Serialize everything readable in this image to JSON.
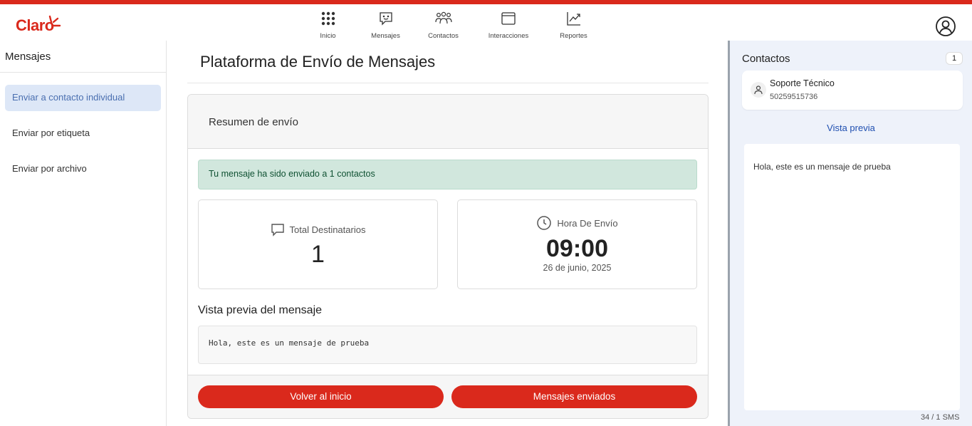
{
  "brand": {
    "logo_text": "Claro",
    "accent_color": "#da291c"
  },
  "nav": {
    "items": [
      {
        "label": "Inicio",
        "icon": "grid-icon"
      },
      {
        "label": "Mensajes",
        "icon": "message-icon"
      },
      {
        "label": "Contactos",
        "icon": "contacts-icon"
      },
      {
        "label": "Interacciones",
        "icon": "window-icon"
      },
      {
        "label": "Reportes",
        "icon": "chart-icon"
      }
    ]
  },
  "sidebar": {
    "title": "Mensajes",
    "items": [
      {
        "label": "Enviar a contacto individual",
        "active": true
      },
      {
        "label": "Enviar por etiqueta",
        "active": false
      },
      {
        "label": "Enviar por archivo",
        "active": false
      }
    ]
  },
  "main": {
    "title": "Plataforma de Envío de Mensajes",
    "card_title": "Resumen de envío",
    "alert": "Tu mensaje ha sido enviado a 1 contactos",
    "total_label": "Total Destinatarios",
    "total_value": "1",
    "time_label": "Hora De Envío",
    "time_value": "09:00",
    "date_value": "26 de junio, 2025",
    "preview_title": "Vista previa del mensaje",
    "preview_text": "Hola, este es un mensaje de prueba",
    "button_home": "Volver al inicio",
    "button_sent": "Mensajes enviados"
  },
  "contacts_panel": {
    "title": "Contactos",
    "count": "1",
    "contact": {
      "name": "Soporte Técnico",
      "phone": "50259515736"
    },
    "preview_label": "Vista previa",
    "preview_text": "Hola, este es un mensaje de prueba",
    "char_count": "34 / 1 SMS"
  }
}
